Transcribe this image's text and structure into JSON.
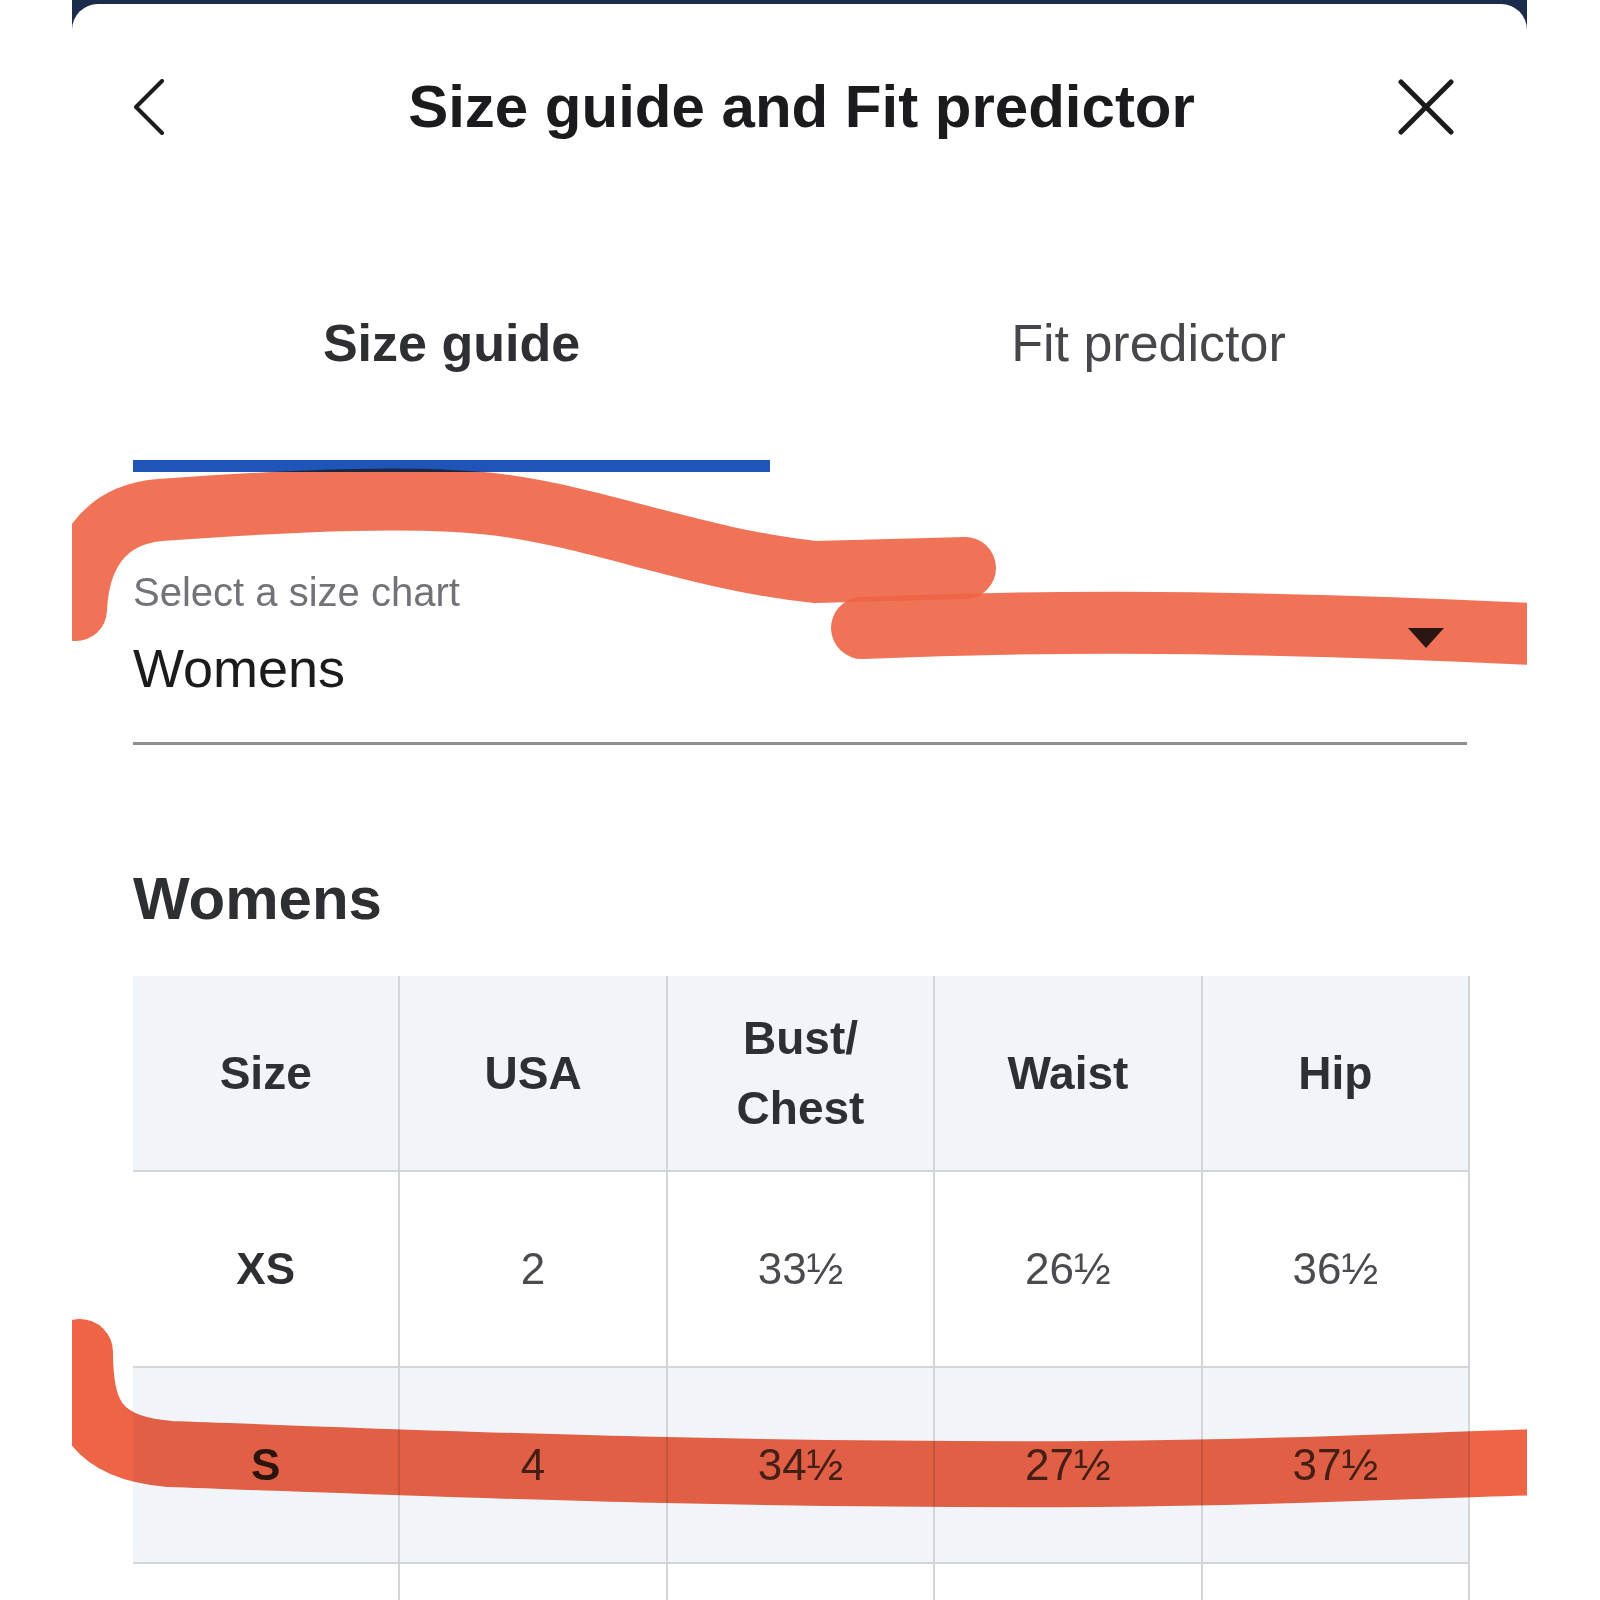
{
  "header": {
    "title": "Size guide and Fit predictor"
  },
  "tabs": [
    {
      "label": "Size guide",
      "selected": true
    },
    {
      "label": "Fit predictor",
      "selected": false
    }
  ],
  "size_chart_select": {
    "label": "Select a size chart",
    "value": "Womens"
  },
  "section_title": "Womens",
  "table": {
    "columns": [
      "Size",
      "USA",
      "Bust/ Chest",
      "Waist",
      "Hip"
    ],
    "rows": [
      {
        "cells": [
          "XS",
          "2",
          "33½",
          "26½",
          "36½"
        ]
      },
      {
        "cells": [
          "S",
          "4",
          "34½",
          "27½",
          "37½"
        ]
      }
    ]
  }
}
